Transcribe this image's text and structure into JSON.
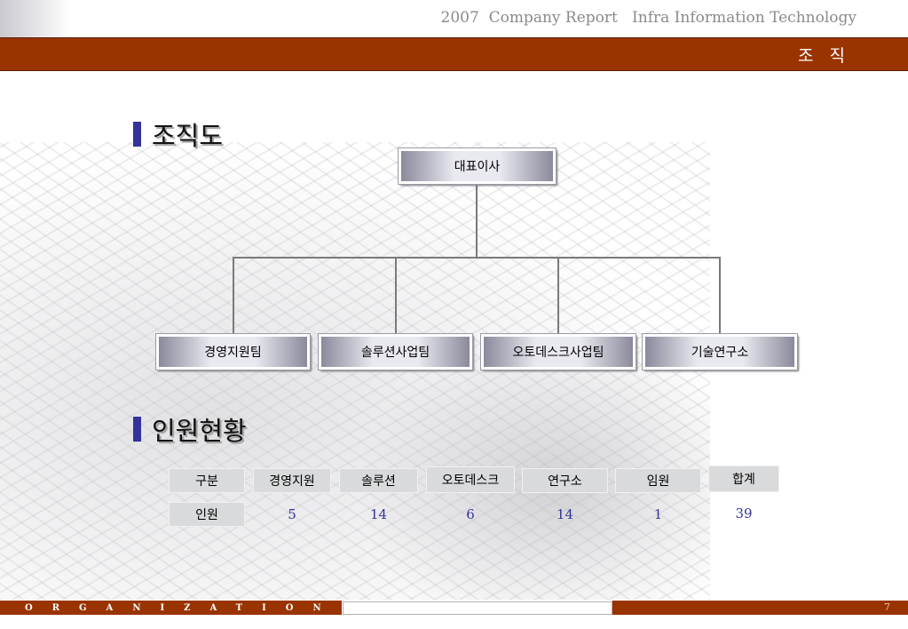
{
  "header": {
    "report_title": "2007  Company Report   Infra Information Technology",
    "section_label": "조 직"
  },
  "org_chart": {
    "heading": "조직도",
    "root": "대표이사",
    "departments": [
      "경영지원팀",
      "솔루션사업팀",
      "오토데스크사업팀",
      "기술연구소"
    ]
  },
  "staff": {
    "heading": "인원현황",
    "columns": [
      "구분",
      "경영지원",
      "솔루션",
      "오토데스크",
      "연구소",
      "임원",
      "합계"
    ],
    "row_label": "인원",
    "values": [
      "5",
      "14",
      "6",
      "14",
      "1",
      "39"
    ]
  },
  "footer": {
    "section_name": "ORGANIZATION",
    "page_number": "7"
  },
  "colors": {
    "brand_bar": "#993300",
    "heading_marker": "#33339a",
    "value_text": "#33339a"
  }
}
